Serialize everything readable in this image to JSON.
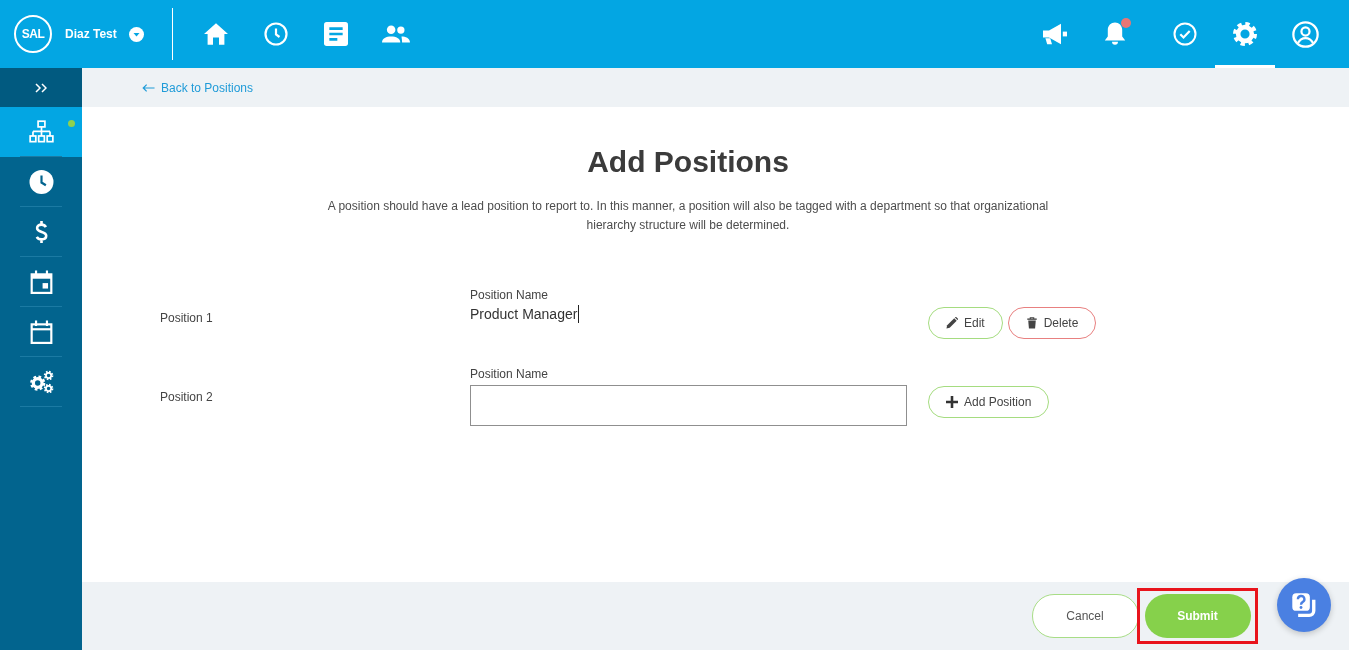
{
  "top_bar": {
    "logo": "SAL",
    "company": "Diaz Test",
    "nav_left": [
      {
        "kind": "home"
      },
      {
        "kind": "clock"
      },
      {
        "kind": "document"
      },
      {
        "kind": "people"
      }
    ],
    "nav_right": [
      {
        "kind": "megaphone",
        "selected": false,
        "unread": false
      },
      {
        "kind": "bell",
        "selected": false,
        "unread": true
      },
      {
        "kind": "check",
        "selected": false,
        "unread": false
      },
      {
        "kind": "gear",
        "selected": true,
        "unread": false
      },
      {
        "kind": "user",
        "selected": false,
        "unread": false
      }
    ]
  },
  "sidebar": {
    "items": [
      {
        "kind": "org-chart",
        "selected": true,
        "dot": true
      },
      {
        "kind": "clock",
        "selected": false,
        "dot": false
      },
      {
        "kind": "dollar",
        "selected": false,
        "dot": false
      },
      {
        "kind": "calendar-day",
        "selected": false,
        "dot": false
      },
      {
        "kind": "calendar",
        "selected": false,
        "dot": false
      },
      {
        "kind": "gears",
        "selected": false,
        "dot": false
      }
    ]
  },
  "breadcrumb": {
    "back_link": "Back to Positions"
  },
  "page": {
    "title": "Add Positions",
    "description": "A position should have a lead position to report to. In this manner, a position will also be tagged with a department so that organizational hierarchy structure will be determined."
  },
  "positions": [
    {
      "label": "Position 1",
      "field_label": "Position Name",
      "kind": "saved",
      "value": "Product Manager",
      "cursor": true,
      "actions": [
        {
          "kind": "edit",
          "label": "Edit"
        },
        {
          "kind": "delete",
          "label": "Delete"
        }
      ]
    },
    {
      "label": "Position 2",
      "field_label": "Position Name",
      "kind": "input",
      "cursor": false,
      "actions": [
        {
          "kind": "add",
          "label": "Add Position"
        }
      ]
    }
  ],
  "footer": {
    "buttons": [
      {
        "kind": "cancel",
        "label": "Cancel",
        "highlighted": false
      },
      {
        "kind": "submit",
        "label": "Submit",
        "highlighted": true
      }
    ]
  }
}
